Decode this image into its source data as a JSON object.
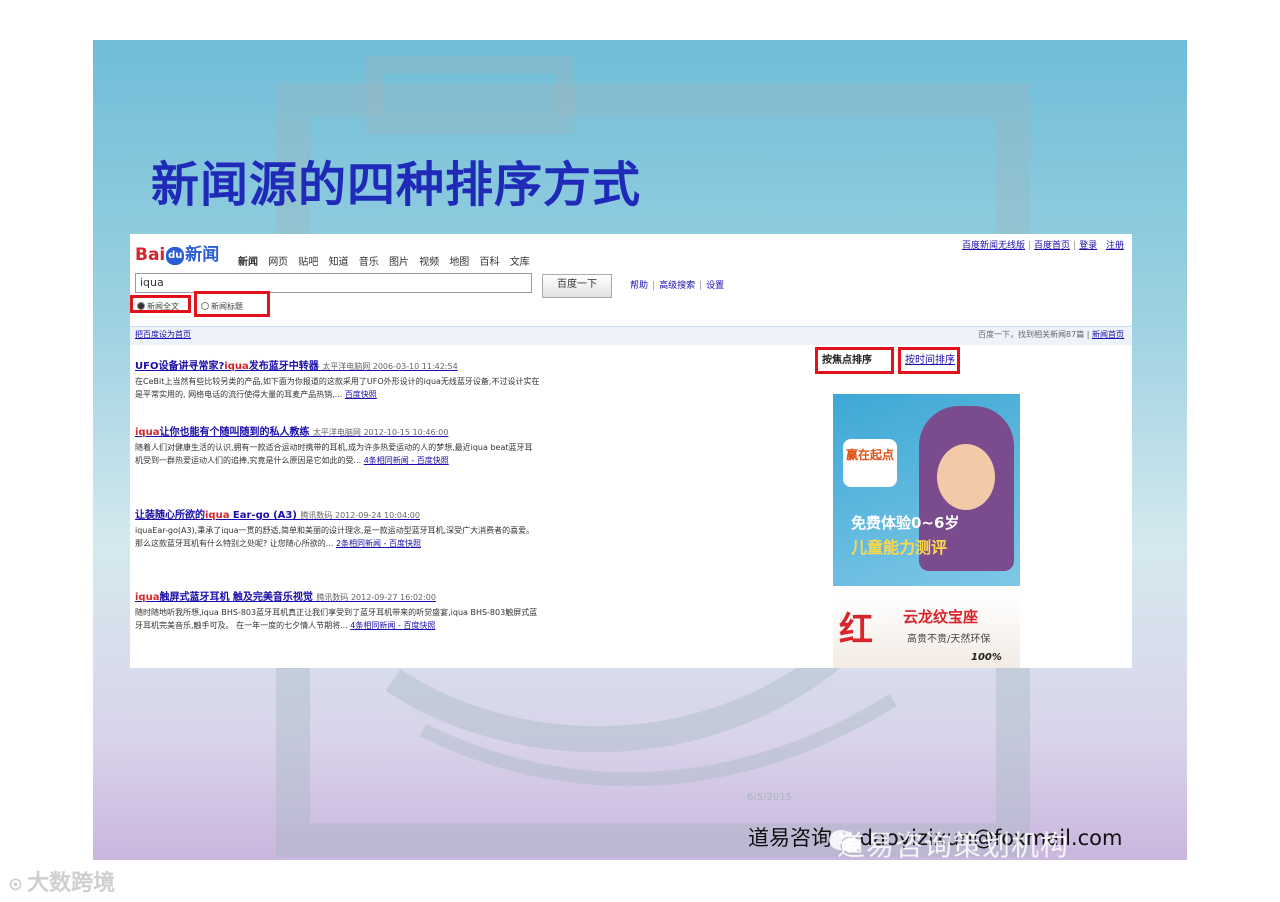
{
  "slide": {
    "title": "新闻源的四种排序方式",
    "page_number": "6/5/2015",
    "contact": "道易咨询 ：daoyizixun@foxmail.com",
    "watermark": "道易咨询策划机构"
  },
  "footer": {
    "brand": "大数跨境"
  },
  "baidu": {
    "logo_prefix": "Bai",
    "logo_paw": "du",
    "logo_news": "新闻",
    "nav": [
      "新闻",
      "网页",
      "贴吧",
      "知道",
      "音乐",
      "图片",
      "视频",
      "地图",
      "百科",
      "文库"
    ],
    "top_links": [
      "百度新闻无线版",
      "百度首页",
      "登录",
      "注册"
    ],
    "search": {
      "value": "iqua",
      "button": "百度一下"
    },
    "help_links": [
      "帮助",
      "高级搜索",
      "设置"
    ],
    "radio": {
      "option1": "新闻全文",
      "option2": "新闻标题"
    },
    "bar": {
      "left": "把百度设为首页",
      "right_text": "百度一下，找到相关新闻87篇 | ",
      "right_link": "新闻首页"
    },
    "sort": {
      "by_focus": "按焦点排序",
      "by_time": "按时间排序"
    },
    "results": [
      {
        "title_a": "UFO设备讲寻常家?",
        "title_kw": "iqua",
        "title_b": "发布蓝牙中转器",
        "source": "太平洋电脑网 2006-03-10 11:42:54",
        "desc": "在CeBit上当然有些比较另类的产品,如下面为你报道的这款采用了UFO外形设计的iqua无线蓝牙设备,不过设计实在是平常实用的, 网络电话的流行使得大量的耳麦产品热销,...",
        "link": "百度快照"
      },
      {
        "title_a": "",
        "title_kw": "iqua",
        "title_b": "让你也能有个随叫随到的私人教练",
        "source": "太平洋电脑网 2012-10-15 10:46:00",
        "desc": "随着人们对健康生活的认识,拥有一款适合运动时携带的耳机,成为许多热爱运动的人的梦想,最近iqua beat蓝牙耳机受到一群热爱运动人们的追捧,究竟是什么原因是它如此的受...",
        "link": "4条相同新闻 - 百度快照"
      },
      {
        "title_a": "让装随心所欲的",
        "title_kw": "iqua",
        "title_b": " Ear-go (A3)",
        "source": "腾讯数码 2012-09-24 10:04:00",
        "desc": "iquaEar-go(A3),秉承了iqua一贯的舒适,简单和美丽的设计理念,是一款运动型蓝牙耳机,深受广大消费者的喜爱。那么这款蓝牙耳机有什么特别之处呢? 让您随心所欲的...",
        "link": "2条相同新闻 - 百度快照"
      },
      {
        "title_a": "",
        "title_kw": "iqua",
        "title_b": "触屏式蓝牙耳机 触及完美音乐视觉",
        "source": "腾讯数码 2012-09-27 16:02:00",
        "desc": "随时随地听我所想,iqua BHS-803蓝牙耳机真正让我们享受到了蓝牙耳机带来的听觉盛宴,iqua BHS-803触屏式蓝牙耳机完美音乐,触手可及。 在一年一度的七夕情人节期将...",
        "link": "4条相同新闻 - 百度快照"
      }
    ],
    "ads": {
      "ad1": {
        "brand": "赢在起点",
        "line1": "免费体验0~6岁",
        "line2": "儿童能力测评"
      },
      "ad2": {
        "mark": "红",
        "name": "云龙纹宝座",
        "slogan": "高贵不贵/天然环保",
        "percent": "100%"
      }
    }
  },
  "colors": {
    "title": "#1f2bb8",
    "highlight": "#e2101a",
    "link": "#1a0dab"
  }
}
